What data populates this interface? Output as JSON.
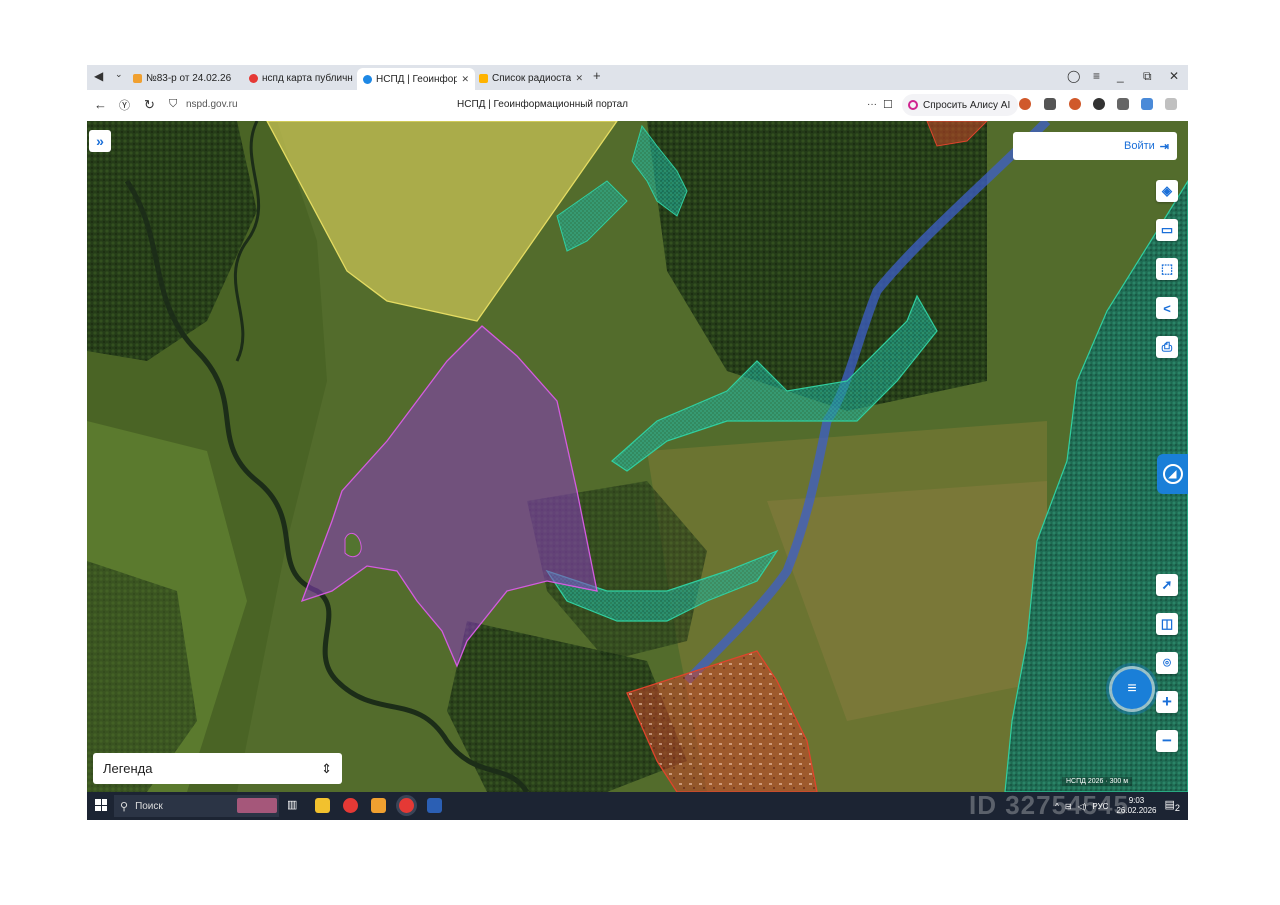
{
  "browser": {
    "tabs": [
      {
        "label": "№83-р от 24.02.26",
        "active": false,
        "favicon_color": "#f0a030"
      },
      {
        "label": "нспд карта публичная ка",
        "active": false,
        "favicon_color": "#e53935"
      },
      {
        "label": "НСПД | Геоинформаци",
        "active": true,
        "favicon_color": "#1e88e5"
      },
      {
        "label": "Список радиостанц",
        "active": false,
        "favicon_color": "#ffb300"
      }
    ],
    "url": "nspd.gov.ru",
    "page_title": "НСПД | Геоинформационный портал",
    "alisa_button": "Спросить Алису AI",
    "more_icon": "···",
    "bookmark_icon": "☐"
  },
  "map": {
    "login_label": "Войти",
    "legend_label": "Легенда",
    "scale_text": "НСПД 2026 · 300 м",
    "tools": [
      "layers-icon",
      "ruler-icon",
      "select-area-icon",
      "share-icon",
      "print-icon"
    ],
    "bottom_tools": [
      "locate-icon",
      "basemap-icon",
      "place-icon",
      "zoom-in-icon",
      "zoom-out-icon"
    ],
    "colors": {
      "parcel_yellow": "#d8cf5a",
      "parcel_purple": "#8a3cc0",
      "forest_teal": "#1aa38a",
      "settlement_red": "#d9442c",
      "road_blue": "#3e5fc9",
      "accent": "#1a7fd8"
    }
  },
  "taskbar": {
    "search_placeholder": "Поиск",
    "language": "РУС",
    "time": "9:03",
    "date": "26.02.2026",
    "notification_count": "2",
    "watermark": "ID 32754545"
  }
}
